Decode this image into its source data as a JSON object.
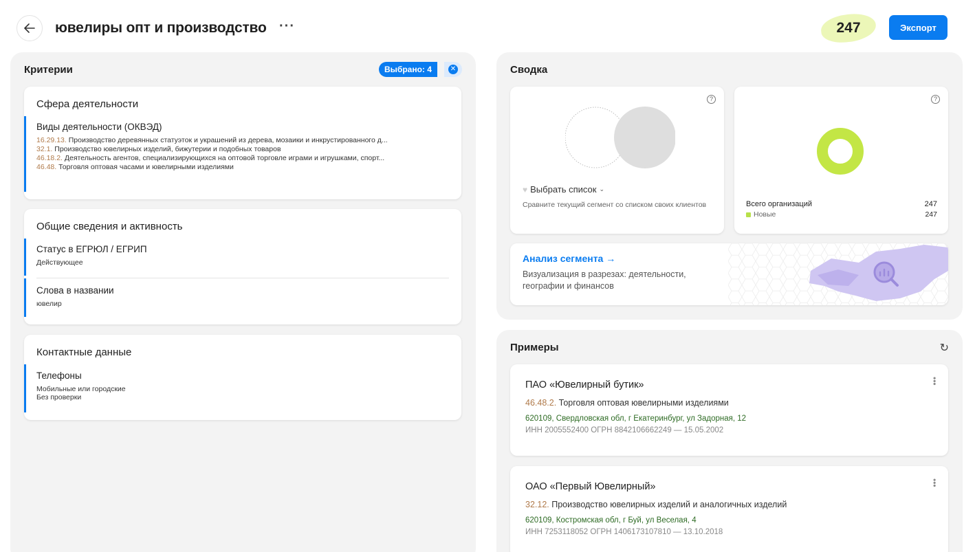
{
  "header": {
    "title": "ювелиры опт и производство",
    "more_label": "···",
    "count": "247",
    "export_label": "Экспорт"
  },
  "criteria": {
    "title": "Критерии",
    "selected_label": "Выбрано: 4",
    "cards": [
      {
        "title": "Сфера деятельности",
        "sections": [
          {
            "title": "Виды деятельности (ОКВЭД)",
            "lines": [
              {
                "code": "16.29.13.",
                "text": " Производство деревянных статуэток и украшений из дерева, мозаики и инкрустированного д..."
              },
              {
                "code": "32.1.",
                "text": " Производство ювелирных изделий, бижутерии и подобных товаров"
              },
              {
                "code": "46.18.2.",
                "text": " Деятельность агентов, специализирующихся на оптовой торговле играми и игрушками, спорт..."
              },
              {
                "code": "46.48.",
                "text": " Торговля оптовая часами и ювелирными изделиями"
              }
            ]
          }
        ]
      },
      {
        "title": "Общие сведения и активность",
        "sections": [
          {
            "title": "Статус в ЕГРЮЛ / ЕГРИП",
            "lines": [
              "Действующее"
            ]
          },
          {
            "title": "Слова в названии",
            "lines": [
              "ювелир"
            ]
          }
        ]
      },
      {
        "title": "Контактные данные",
        "sections": [
          {
            "title": "Телефоны",
            "lines": [
              "Мобильные или городские",
              "Без проверки"
            ]
          }
        ]
      }
    ]
  },
  "summary": {
    "title": "Сводка",
    "choose_list_label": "Выбрать список",
    "choose_list_desc": "Сравните текущий сегмент со списком своих клиентов",
    "total_label": "Всего организаций",
    "total_value": "247",
    "new_label": "Новые",
    "new_value": "247",
    "analysis_title": "Анализ сегмента →",
    "analysis_desc": "Визуализация в разрезах: деятельности, географии и финансов",
    "colors": {
      "accent": "#0a7cf0",
      "donut": "#c3e645",
      "map": "#cfc6f2"
    }
  },
  "examples": {
    "title": "Примеры",
    "items": [
      {
        "name": "ПАО «Ювелирный бутик»",
        "code": "46.48.2.",
        "okved": " Торговля оптовая ювелирными изделиями",
        "address": "620109, Свердловская обл, г Екатеринбург, ул Задорная, 12",
        "ids": "ИНН 2005552400    ОГРН 8842106662249 — 15.05.2002"
      },
      {
        "name": "ОАО «Первый Ювелирный»",
        "code": "32.12.",
        "okved": " Производство ювелирных изделий и аналогичных изделий",
        "address": "620109, Костромская обл, г Буй, ул Веселая, 4",
        "ids": "ИНН 7253118052    ОГРН 1406173107810 — 13.10.2018"
      }
    ]
  }
}
